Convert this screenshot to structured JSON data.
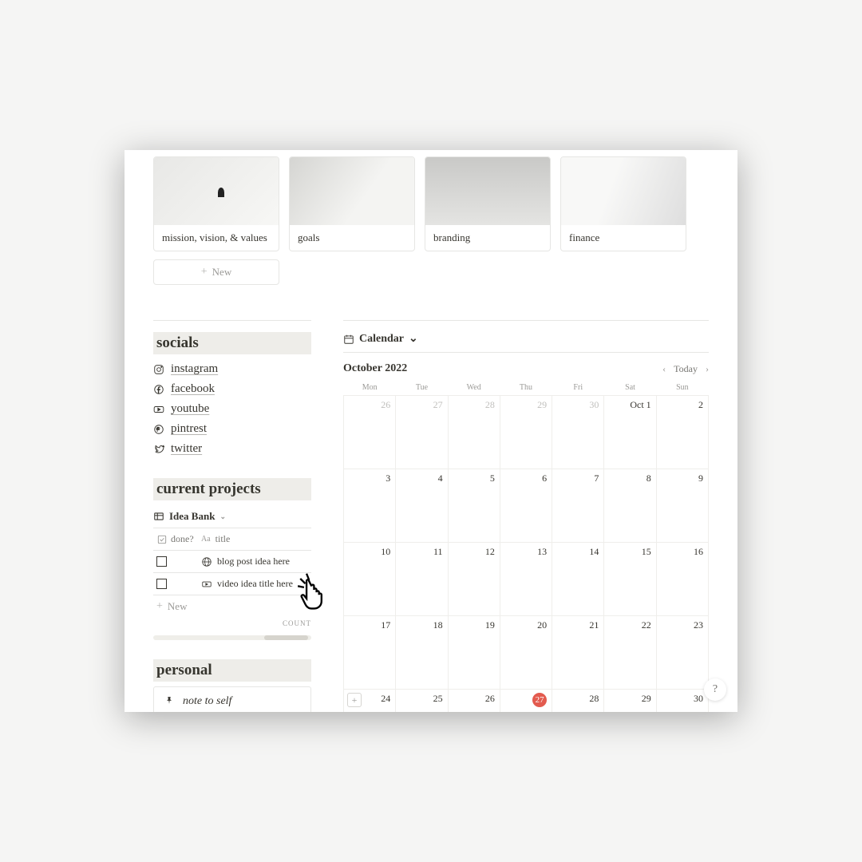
{
  "gallery": {
    "cards": [
      {
        "label": "mission, vision, & values"
      },
      {
        "label": "goals"
      },
      {
        "label": "branding"
      },
      {
        "label": "finance"
      }
    ],
    "new_label": "New"
  },
  "socials": {
    "title": "socials",
    "items": [
      {
        "label": "instagram"
      },
      {
        "label": "facebook"
      },
      {
        "label": "youtube"
      },
      {
        "label": "pintrest"
      },
      {
        "label": "twitter"
      }
    ]
  },
  "projects": {
    "title": "current projects",
    "view_label": "Idea Bank",
    "col_done": "done?",
    "col_title_prefix": "Aa",
    "col_title": "title",
    "rows": [
      {
        "title": "blog post idea here"
      },
      {
        "title": "video idea title here"
      }
    ],
    "new_label": "New",
    "count_label": "COUNT"
  },
  "personal": {
    "title": "personal",
    "note_label": "note to self"
  },
  "calendar": {
    "view_label": "Calendar",
    "month_label": "October 2022",
    "today_label": "Today",
    "day_headers": [
      "Mon",
      "Tue",
      "Wed",
      "Thu",
      "Fri",
      "Sat",
      "Sun"
    ],
    "weeks": [
      [
        {
          "n": "26",
          "other": true
        },
        {
          "n": "27",
          "other": true
        },
        {
          "n": "28",
          "other": true
        },
        {
          "n": "29",
          "other": true
        },
        {
          "n": "30",
          "other": true
        },
        {
          "n": "Oct 1"
        },
        {
          "n": "2"
        }
      ],
      [
        {
          "n": "3"
        },
        {
          "n": "4"
        },
        {
          "n": "5"
        },
        {
          "n": "6"
        },
        {
          "n": "7"
        },
        {
          "n": "8"
        },
        {
          "n": "9"
        }
      ],
      [
        {
          "n": "10"
        },
        {
          "n": "11"
        },
        {
          "n": "12"
        },
        {
          "n": "13"
        },
        {
          "n": "14"
        },
        {
          "n": "15"
        },
        {
          "n": "16"
        }
      ],
      [
        {
          "n": "17"
        },
        {
          "n": "18"
        },
        {
          "n": "19"
        },
        {
          "n": "20"
        },
        {
          "n": "21"
        },
        {
          "n": "22"
        },
        {
          "n": "23"
        }
      ],
      [
        {
          "n": "24",
          "add": true
        },
        {
          "n": "25"
        },
        {
          "n": "26"
        },
        {
          "n": "27",
          "today": true
        },
        {
          "n": "28"
        },
        {
          "n": "29"
        },
        {
          "n": "30"
        }
      ]
    ]
  },
  "help_label": "?"
}
